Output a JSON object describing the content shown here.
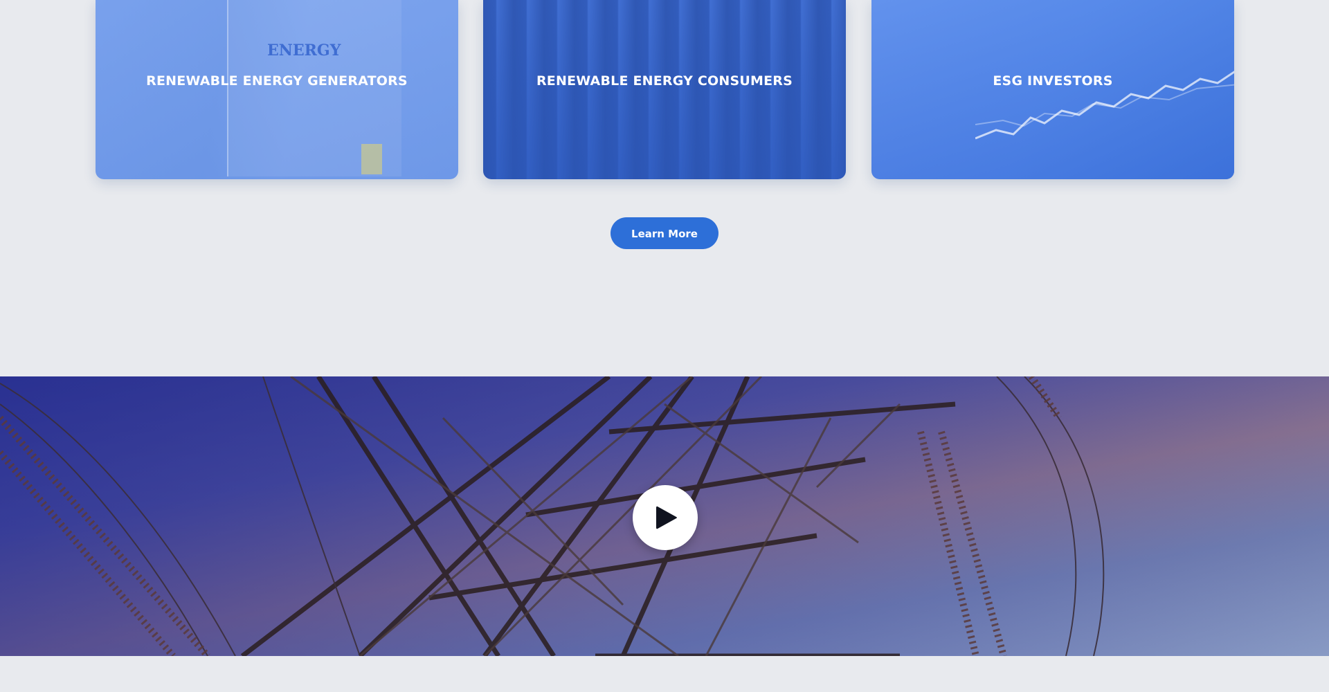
{
  "cards": [
    {
      "title": "RENEWABLE ENERGY GENERATORS",
      "image_text": "ENERGY"
    },
    {
      "title": "RENEWABLE ENERGY CONSUMERS"
    },
    {
      "title": "ESG INVESTORS"
    }
  ],
  "cta": {
    "label": "Learn More"
  },
  "video": {
    "play_icon": "play-icon"
  },
  "colors": {
    "background": "#e8eaee",
    "accent": "#2d6fd8",
    "card_overlay": "#5a8ceb"
  }
}
